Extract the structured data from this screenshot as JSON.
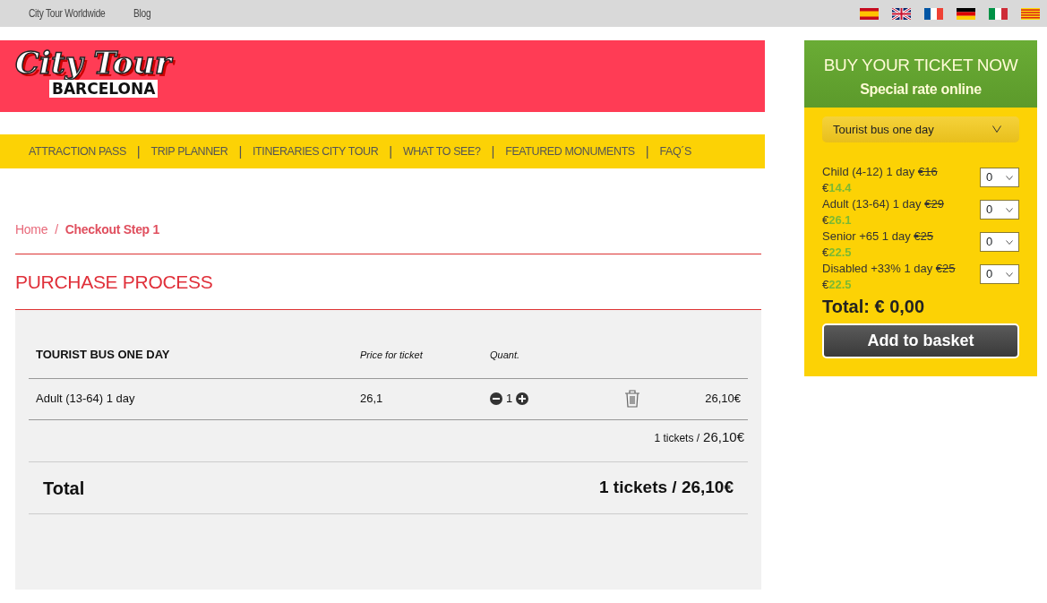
{
  "top_links": [
    "City Tour Worldwide",
    "Blog"
  ],
  "flags": [
    {
      "kind": "es"
    },
    {
      "kind": "gb"
    },
    {
      "kind": "fr"
    },
    {
      "kind": "de"
    },
    {
      "kind": "it"
    },
    {
      "kind": "cat"
    }
  ],
  "logo": {
    "line_1": "City Tour",
    "line_2": "BARCELONA"
  },
  "nav_separator": "|",
  "breadcrumb_separator": "/",
  "nav": [
    "ATTRACTION PASS",
    "TRIP PLANNER",
    "ITINERARIES CITY TOUR",
    "WHAT TO SEE?",
    "FEATURED MONUMENTS",
    "FAQ´S"
  ],
  "breadcrumb": [
    {
      "label": "Home",
      "selected": false
    },
    {
      "label": "Checkout Step 1",
      "selected": true
    }
  ],
  "page_title": "PURCHASE PROCESS",
  "cart": {
    "product": "TOURIST BUS ONE DAY",
    "price_header": "Price for ticket",
    "quantity_header": "Quant.",
    "rows": [
      {
        "name": "Adult (13-64) 1 day",
        "price": "26,1",
        "quantity": "1",
        "subtotal": "26,10€"
      }
    ],
    "summary_count": "1 tickets /",
    "summary_amount": "26,10€",
    "total_label": "Total",
    "total_value": "1 tickets / 26,10€"
  },
  "sidebar": {
    "title": "BUY YOUR TICKET NOW",
    "subtitle": "Special rate online",
    "product_select": "Tourist bus one day",
    "options": [
      {
        "label": "Child (4-12) 1 day",
        "old_price": "€16",
        "new_price": "€**14.4**",
        "quantity": "0"
      },
      {
        "label": "Adult (13-64) 1 day",
        "old_price": "€29",
        "new_price": "€**26.1**",
        "quantity": "0"
      },
      {
        "label": "Senior +65 1 day",
        "old_price": "€25",
        "new_price": "€**22.5**",
        "quantity": "0"
      },
      {
        "label": "Disabled +33% 1 day",
        "old_price": "€25",
        "new_price": "€**22.5**",
        "quantity": "0"
      }
    ],
    "total": "Total: € 0,00",
    "button": "Add to basket"
  }
}
